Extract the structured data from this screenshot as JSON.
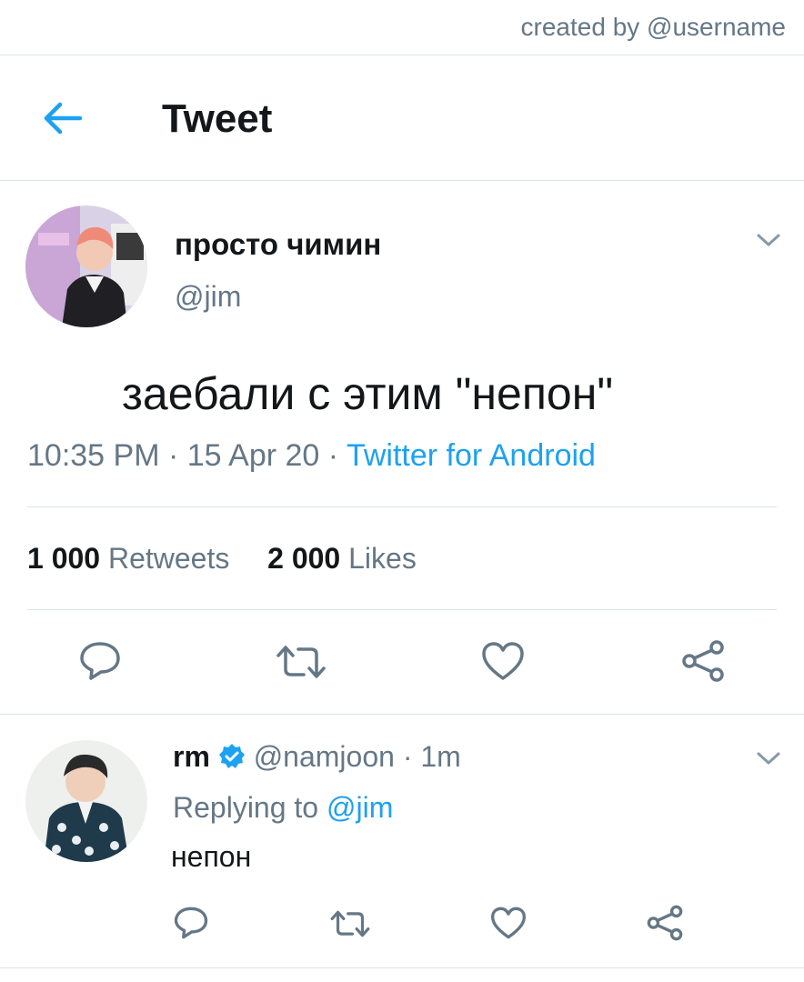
{
  "watermark": "created by @username",
  "header": {
    "title": "Tweet",
    "back_icon": "arrow-left-icon"
  },
  "tweet": {
    "display_name": "просто чимин",
    "handle": "@jim",
    "text": "заебали с этим \"непон\"",
    "time": "10:35 PM",
    "date": "15 Apr 20",
    "source": "Twitter for Android",
    "retweets_count": "1 000",
    "retweets_label": "Retweets",
    "likes_count": "2 000",
    "likes_label": "Likes",
    "actions": [
      "reply-icon",
      "retweet-icon",
      "like-icon",
      "share-icon"
    ]
  },
  "reply": {
    "display_name": "rm",
    "verified": true,
    "handle": "@namjoon",
    "time": "1m",
    "replying_to_label": "Replying to",
    "replying_to_handle": "@jim",
    "text": "непон"
  },
  "colors": {
    "accent": "#1da1f2",
    "muted": "#657786",
    "text": "#14171a",
    "border": "#dde3e8"
  }
}
